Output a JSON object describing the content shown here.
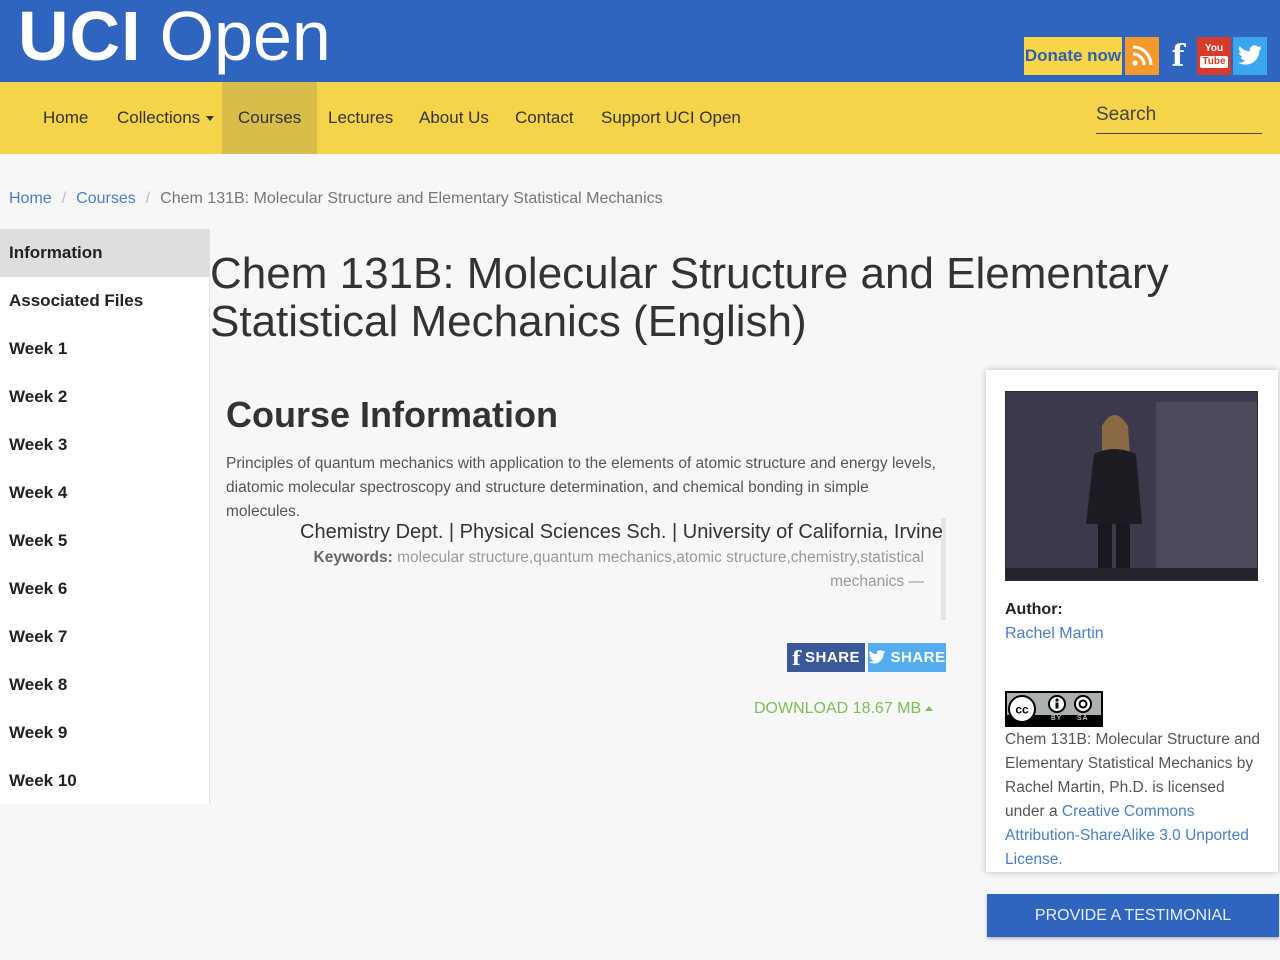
{
  "header": {
    "logo_bold": "UCI",
    "logo_light": "Open",
    "donate_label": "Donate now",
    "social": {
      "youtube_top": "You",
      "youtube_bottom": "Tube"
    }
  },
  "nav": {
    "items": [
      "Home",
      "Collections",
      "Courses",
      "Lectures",
      "About Us",
      "Contact",
      "Support UCI Open"
    ],
    "active": "Courses",
    "search_placeholder": "Search"
  },
  "breadcrumb": {
    "home": "Home",
    "courses": "Courses",
    "current": "Chem 131B: Molecular Structure and Elementary Statistical Mechanics",
    "separator": "/"
  },
  "sidebar": {
    "items": [
      "Information",
      "Associated Files",
      "Week 1",
      "Week 2",
      "Week 3",
      "Week 4",
      "Week 5",
      "Week 6",
      "Week 7",
      "Week 8",
      "Week 9",
      "Week 10"
    ],
    "active": "Information"
  },
  "main": {
    "title": "Chem 131B: Molecular Structure and Elementary Statistical Mechanics (English)",
    "section_title": "Course Information",
    "description": "Principles of quantum mechanics with application to the elements of atomic structure and energy levels, diatomic molecular spectroscopy and structure determination, and chemical bonding in simple molecules.",
    "dept": "Chemistry Dept. | Physical Sciences Sch. | University of California, Irvine",
    "keywords_label": "Keywords:",
    "keywords": "molecular structure,quantum mechanics,atomic structure,chemistry,statistical mechanics —",
    "share_label": "SHARE",
    "download": "DOWNLOAD 18.67 MB"
  },
  "card": {
    "author_label": "Author:",
    "author_name": "Rachel Martin",
    "cc_by": "BY",
    "cc_sa": "SA",
    "license_prefix": "Chem 131B: Molecular Structure and Elementary Statistical Mechanics by Rachel Martin, Ph.D. is licensed under a",
    "license_link": "Creative Commons Attribution-ShareAlike 3.0 Unported License.",
    "testimonial_label": "PROVIDE A TESTIMONIAL"
  },
  "colors": {
    "header_blue": "#2f65bf",
    "nav_yellow": "#f6d44a",
    "link_blue": "#4a7ec4",
    "download_green": "#7dbe57"
  },
  "icons": [
    "rss-icon",
    "facebook-icon",
    "youtube-icon",
    "twitter-icon",
    "creative-commons-icon"
  ]
}
